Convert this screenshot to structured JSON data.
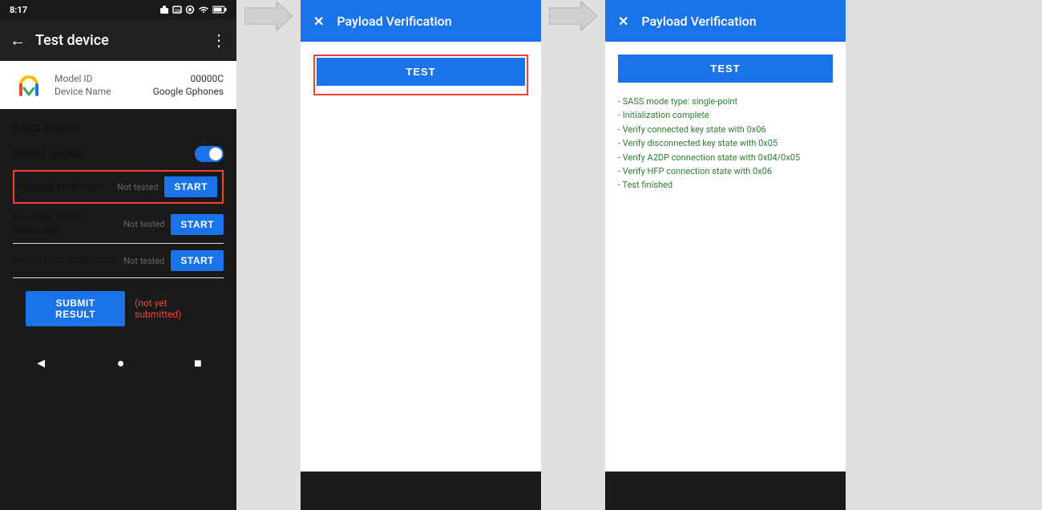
{
  "phone": {
    "statusBar": {
      "time": "8:17",
      "icons": "signal wifi battery"
    },
    "appBar": {
      "back": "←",
      "title": "Test device",
      "more": "⋮"
    },
    "deviceInfo": {
      "modelLabel": "Model ID",
      "modelValue": "00000C",
      "deviceLabel": "Device Name",
      "deviceValue": "Google Gphones"
    },
    "sassTitle": "SASS Steps:",
    "selectDevice": "Select device",
    "steps": [
      {
        "name": "Payload Verification",
        "status": "Not tested",
        "btnLabel": "START",
        "highlighted": true
      },
      {
        "name": "Message Stream Verification",
        "status": "Not tested",
        "btnLabel": "START",
        "highlighted": false
      },
      {
        "name": "Switch Back Verification",
        "status": "Not tested",
        "btnLabel": "START",
        "highlighted": false
      }
    ],
    "submitBtn": "SUBMIT RESULT",
    "submitNote": "(not yet submitted)",
    "nav": {
      "back": "◄",
      "home": "●",
      "recent": "■"
    }
  },
  "dialog1": {
    "close": "✕",
    "title": "Payload Verification",
    "testBtn": "TEST",
    "highlighted": true
  },
  "dialog2": {
    "close": "✕",
    "title": "Payload Verification",
    "testBtn": "TEST",
    "logs": [
      "- SASS mode type: single-point",
      "- Initialization complete",
      "- Verify connected key state with 0x06",
      "- Verify disconnected key state with 0x05",
      "- Verify A2DP connection state with 0x04/0x05",
      "- Verify HFP connection state with 0x06",
      "- Test finished"
    ]
  },
  "arrows": {
    "symbol": "→"
  }
}
